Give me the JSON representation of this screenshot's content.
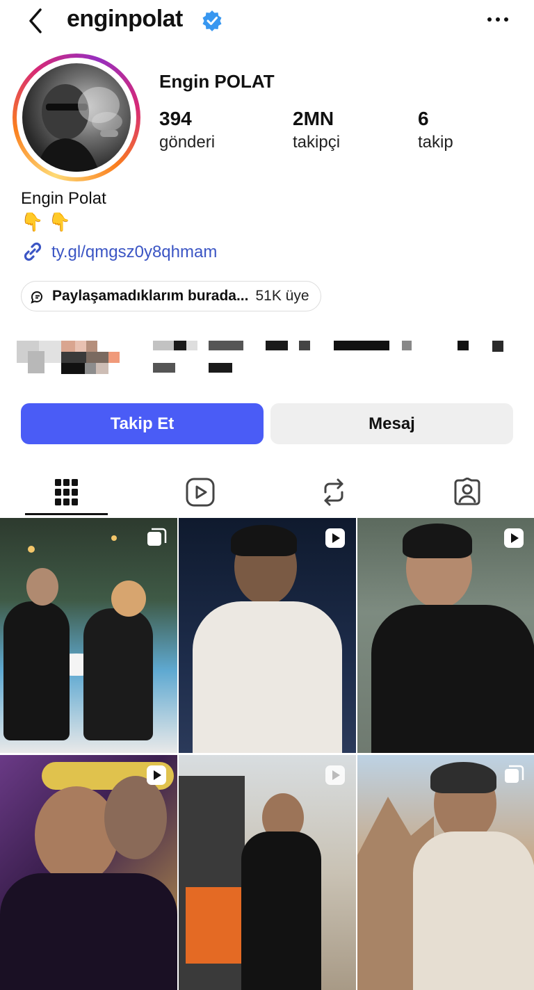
{
  "header": {
    "username": "enginpolat",
    "back_icon": "chevron-left-icon",
    "verified_icon": "verified-badge-icon",
    "more_icon": "more-horizontal-icon"
  },
  "profile": {
    "display_name": "Engin POLAT",
    "stats": [
      {
        "value": "394",
        "label": "gönderi"
      },
      {
        "value": "2MN",
        "label": "takipçi"
      },
      {
        "value": "6",
        "label": "takip"
      }
    ]
  },
  "bio": {
    "name": "Engin Polat",
    "emoji": "👇 👇",
    "link": "ty.gl/qmgsz0y8qhmam"
  },
  "channel": {
    "title": "Paylaşamadıklarım burada...",
    "members": "51K üye"
  },
  "actions": {
    "follow": "Takip Et",
    "message": "Mesaj"
  },
  "tabs": [
    {
      "name": "posts",
      "icon": "grid-icon",
      "active": true
    },
    {
      "name": "reels",
      "icon": "reels-icon",
      "active": false
    },
    {
      "name": "reposts",
      "icon": "repost-icon",
      "active": false
    },
    {
      "name": "tagged",
      "icon": "tagged-icon",
      "active": false
    }
  ],
  "colors": {
    "accent": "#4a5cf6",
    "link": "#3b55c4",
    "verified": "#3897f0",
    "secondary_button": "#efefef"
  }
}
